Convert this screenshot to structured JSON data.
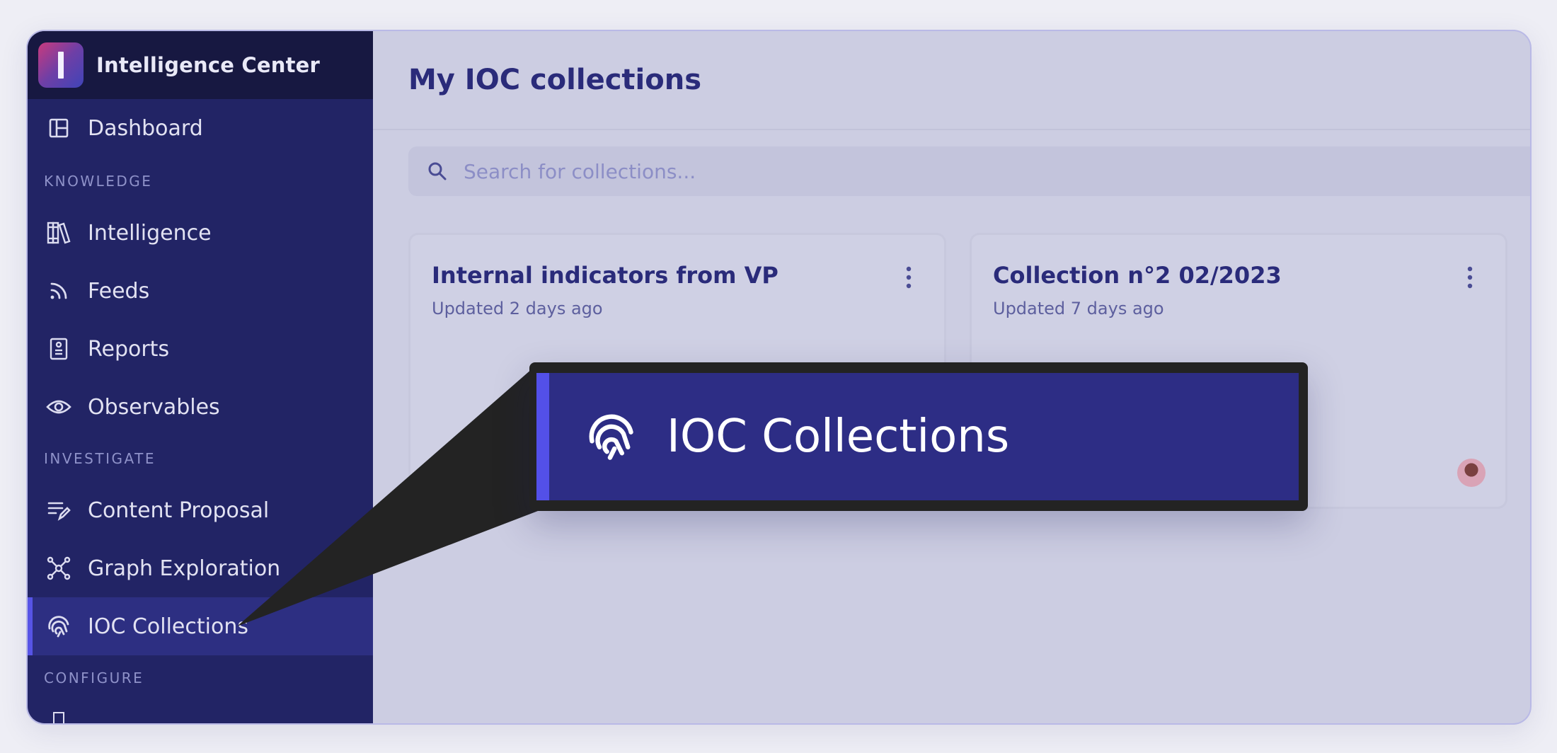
{
  "app": {
    "name": "Intelligence Center"
  },
  "sidebar": {
    "items": [
      {
        "label": "Dashboard",
        "icon": "dashboard-icon"
      },
      {
        "label": "Intelligence",
        "icon": "library-icon"
      },
      {
        "label": "Feeds",
        "icon": "rss-icon"
      },
      {
        "label": "Reports",
        "icon": "report-icon"
      },
      {
        "label": "Observables",
        "icon": "eye-icon"
      },
      {
        "label": "Content Proposal",
        "icon": "edit-list-icon"
      },
      {
        "label": "Graph Exploration",
        "icon": "graph-icon"
      },
      {
        "label": "IOC Collections",
        "icon": "fingerprint-icon",
        "active": true
      }
    ],
    "sections": {
      "knowledge": "KNOWLEDGE",
      "investigate": "INVESTIGATE",
      "configure": "CONFIGURE"
    }
  },
  "main": {
    "title": "My IOC collections",
    "search_placeholder": "Search for collections...",
    "cards": [
      {
        "title": "Internal indicators from VP",
        "updated": "Updated 2 days ago"
      },
      {
        "title": "Collection n°2 02/2023",
        "updated": "Updated 7 days ago"
      }
    ]
  },
  "callout": {
    "label": "IOC Collections",
    "icon": "fingerprint-icon"
  },
  "colors": {
    "sidebar_bg": "#222465",
    "accent": "#5754e6",
    "title": "#2a2b7a",
    "callout_bg": "#2d2d85"
  }
}
